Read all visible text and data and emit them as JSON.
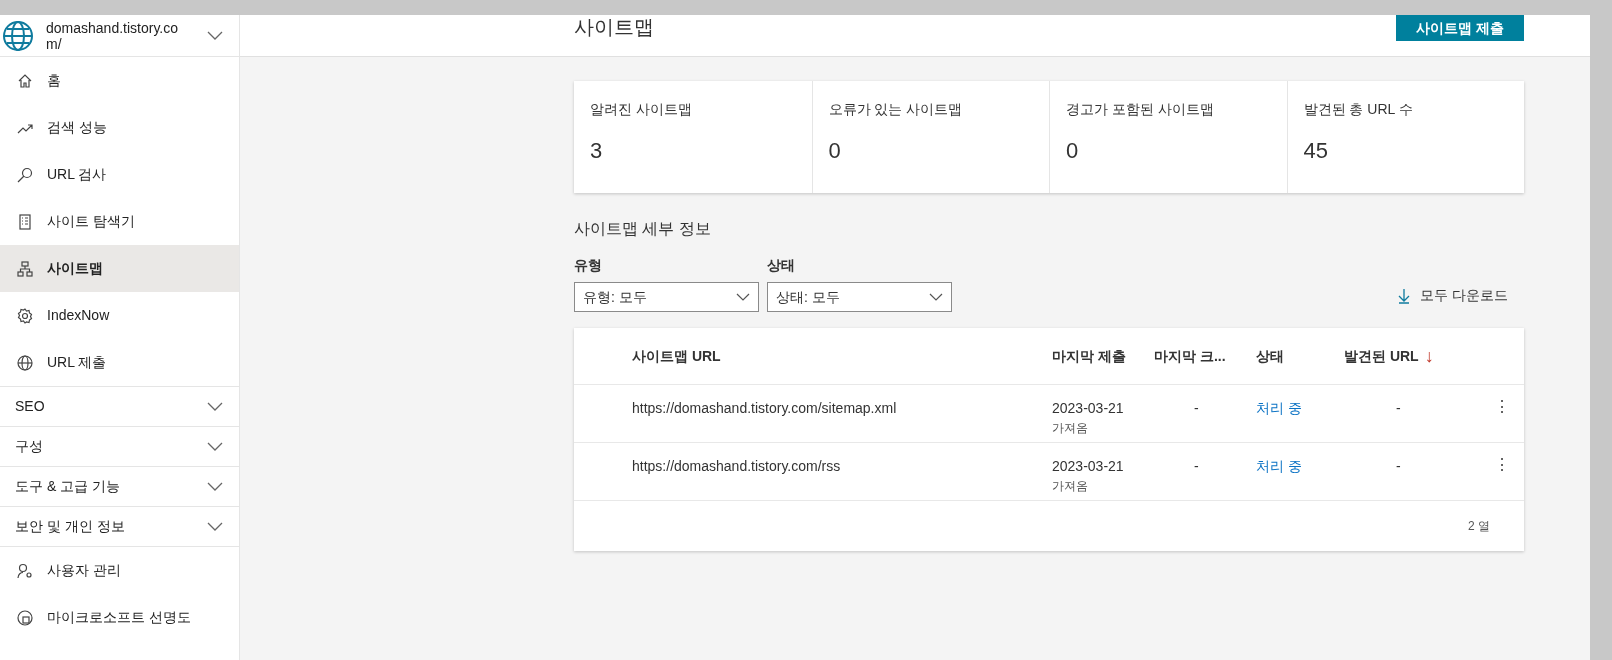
{
  "site_selector": {
    "label": "domashand.tistory.com/"
  },
  "sidebar": {
    "items": [
      {
        "kind": "link",
        "label": "홈",
        "selected": false
      },
      {
        "kind": "link",
        "label": "검색 성능",
        "selected": false
      },
      {
        "kind": "link",
        "label": "URL 검사",
        "selected": false
      },
      {
        "kind": "link",
        "label": "사이트 탐색기",
        "selected": false
      },
      {
        "kind": "link",
        "label": "사이트맵",
        "selected": true
      },
      {
        "kind": "link",
        "label": "IndexNow",
        "selected": false
      },
      {
        "kind": "link",
        "label": "URL 제출",
        "selected": false
      },
      {
        "kind": "section",
        "label": "SEO",
        "expanded": false
      },
      {
        "kind": "section",
        "label": "구성",
        "expanded": false
      },
      {
        "kind": "section",
        "label": "도구 & 고급 기능",
        "expanded": false
      },
      {
        "kind": "section",
        "label": "보안 및 개인 정보",
        "expanded": false
      },
      {
        "kind": "link",
        "label": "사용자 관리",
        "selected": false
      },
      {
        "kind": "link",
        "label": "마이크로소프트 선명도",
        "selected": false
      }
    ]
  },
  "header": {
    "title": "사이트맵",
    "submit_button": "사이트맵 제출"
  },
  "stats": [
    {
      "label": "알려진 사이트맵",
      "value": "3"
    },
    {
      "label": "오류가 있는 사이트맵",
      "value": "0"
    },
    {
      "label": "경고가 포함된 사이트맵",
      "value": "0"
    },
    {
      "label": "발견된 총 URL 수",
      "value": "45"
    }
  ],
  "details": {
    "title": "사이트맵 세부 정보",
    "filters": [
      {
        "label": "유형",
        "value": "유형: 모두"
      },
      {
        "label": "상태",
        "value": "상태: 모두"
      }
    ],
    "download": "모두 다운로드",
    "table": {
      "columns": [
        "사이트맵 URL",
        "마지막 제출",
        "마지막 크...",
        "상태",
        "발견된 URL"
      ],
      "sort_indicator": "↓",
      "rows": [
        {
          "url": "https://domashand.tistory.com/sitemap.xml",
          "submitted": "2023-03-21",
          "source": "가져옴",
          "last_crawl": "-",
          "status": "처리 중",
          "found": "-",
          "menu": "⋮"
        },
        {
          "url": "https://domashand.tistory.com/rss",
          "submitted": "2023-03-21",
          "source": "가져옴",
          "last_crawl": "-",
          "status": "처리 중",
          "found": "-",
          "menu": "⋮"
        }
      ],
      "footer": "2 열"
    }
  }
}
